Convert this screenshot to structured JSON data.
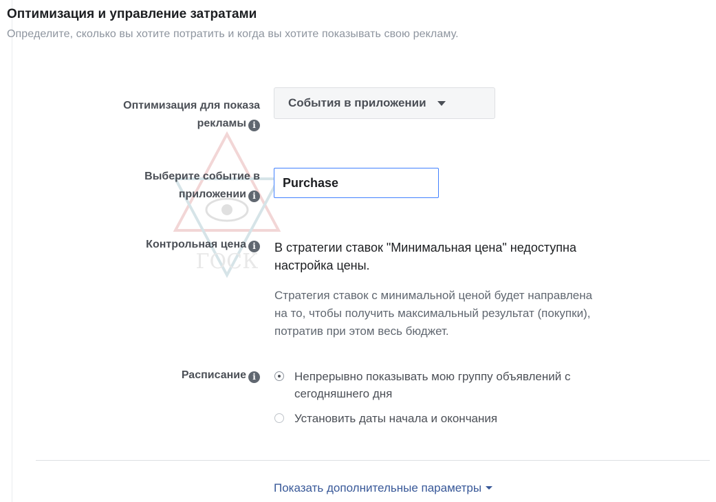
{
  "header": {
    "title": "Оптимизация и управление затратами",
    "subtitle": "Определите, сколько вы хотите потратить и когда вы хотите показывать свою рекламу."
  },
  "optimization": {
    "label_line1": "Оптимизация для показа",
    "label_line2": "рекламы",
    "dropdown_value": "События в приложении"
  },
  "app_event": {
    "label_line1": "Выберите событие в",
    "label_line2": "приложении",
    "input_value": "Purchase"
  },
  "bid_control": {
    "label": "Контрольная цена",
    "main_line1": "В стратегии ставок \"Минимальная цена\" недоступна",
    "main_line2": "настройка цены.",
    "desc_line1": "Стратегия ставок с минимальной ценой будет направлена",
    "desc_line2": "на то, чтобы получить максимальный результат (покупки),",
    "desc_line3": "потратив при этом весь бюджет."
  },
  "schedule": {
    "label": "Расписание",
    "options": [
      {
        "line1": "Непрерывно показывать мою группу объявлений с",
        "line2": "сегодняшнего дня",
        "selected": true
      },
      {
        "line1": "Установить даты начала и окончания",
        "selected": false
      }
    ]
  },
  "footer": {
    "more_link": "Показать дополнительные параметры"
  },
  "watermark": {
    "text": "ГОСК"
  },
  "colors": {
    "link": "#385898",
    "input_focus": "#4080ff",
    "muted_text": "#8d949e"
  }
}
